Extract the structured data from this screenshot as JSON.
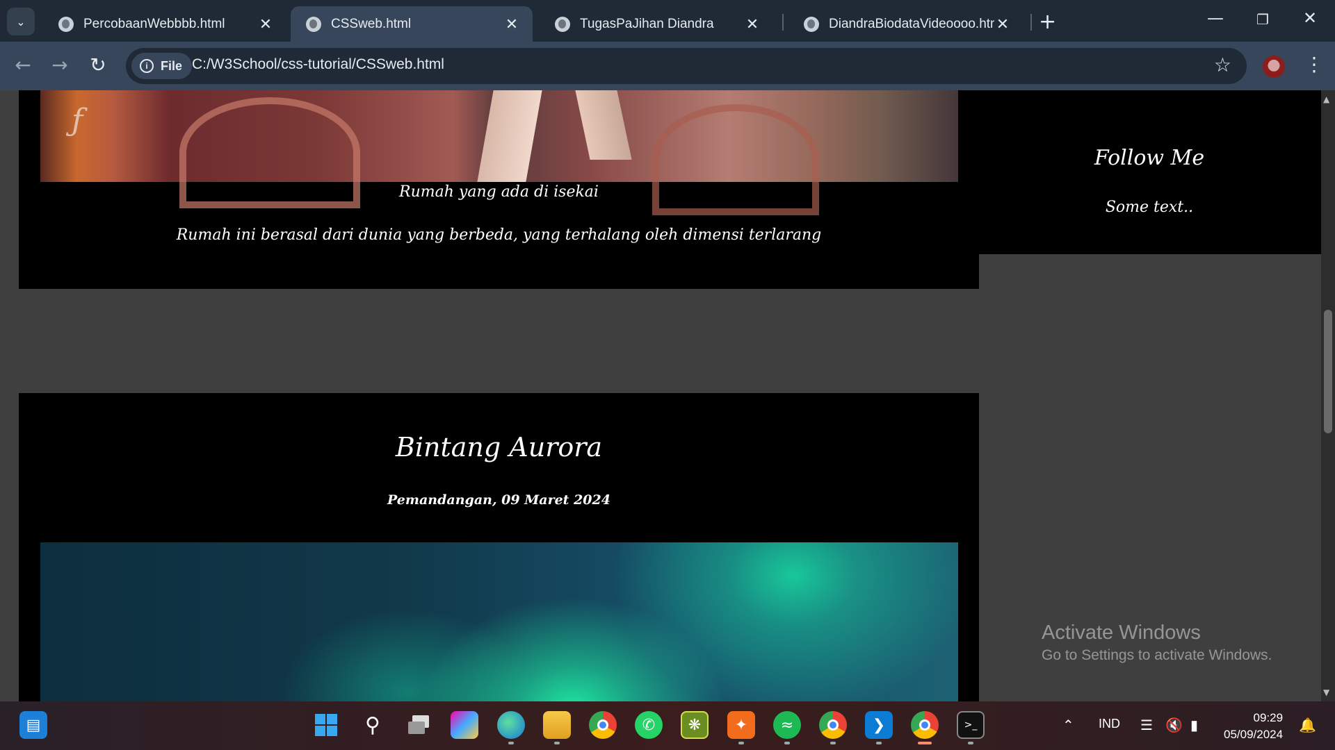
{
  "browser": {
    "tabs": [
      {
        "title": "PercobaanWebbbb.html",
        "active": false
      },
      {
        "title": "CSSweb.html",
        "active": true
      },
      {
        "title": "TugasPaJihan Diandra",
        "active": false
      },
      {
        "title": "DiandraBiodataVideoooo.html",
        "active": false
      }
    ],
    "new_tab_label": "+",
    "address": {
      "chip_label": "File",
      "url": "C:/W3School/css-tutorial/CSSweb.html"
    }
  },
  "page": {
    "card1": {
      "caption_title": "Rumah yang ada di isekai",
      "caption_text": "Rumah ini berasal dari dunia yang berbeda, yang terhalang oleh dimensi terlarang"
    },
    "card2": {
      "heading": "Bintang Aurora",
      "date": "Pemandangan, 09 Maret 2024"
    },
    "sidebar": {
      "follow_title": "Follow Me",
      "follow_text": "Some text.."
    }
  },
  "watermark": {
    "line1": "Activate Windows",
    "line2": "Go to Settings to activate Windows."
  },
  "taskbar": {
    "icons": [
      "widgets-icon",
      "start-icon",
      "search-icon",
      "task-view-icon",
      "copilot-icon",
      "edge-icon",
      "file-explorer-icon",
      "chrome-icon",
      "whatsapp-icon",
      "app-icon",
      "xampp-icon",
      "spotify-icon",
      "chrome-icon",
      "vscode-icon",
      "chrome-active-icon",
      "terminal-icon"
    ],
    "language": "IND",
    "time": "09:29",
    "date": "05/09/2024"
  },
  "colors": {
    "tabbar": "#1f2a36",
    "toolbar": "#37465a",
    "page_bg": "#3f3f3f",
    "card_bg": "#000000"
  }
}
